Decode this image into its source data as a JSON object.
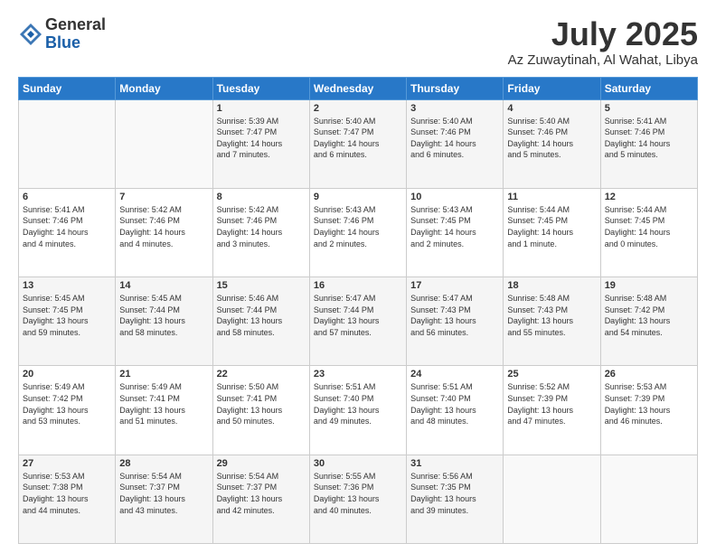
{
  "logo": {
    "general": "General",
    "blue": "Blue"
  },
  "title": "July 2025",
  "location": "Az Zuwaytinah, Al Wahat, Libya",
  "headers": [
    "Sunday",
    "Monday",
    "Tuesday",
    "Wednesday",
    "Thursday",
    "Friday",
    "Saturday"
  ],
  "weeks": [
    [
      {
        "day": "",
        "info": ""
      },
      {
        "day": "",
        "info": ""
      },
      {
        "day": "1",
        "info": "Sunrise: 5:39 AM\nSunset: 7:47 PM\nDaylight: 14 hours\nand 7 minutes."
      },
      {
        "day": "2",
        "info": "Sunrise: 5:40 AM\nSunset: 7:47 PM\nDaylight: 14 hours\nand 6 minutes."
      },
      {
        "day": "3",
        "info": "Sunrise: 5:40 AM\nSunset: 7:46 PM\nDaylight: 14 hours\nand 6 minutes."
      },
      {
        "day": "4",
        "info": "Sunrise: 5:40 AM\nSunset: 7:46 PM\nDaylight: 14 hours\nand 5 minutes."
      },
      {
        "day": "5",
        "info": "Sunrise: 5:41 AM\nSunset: 7:46 PM\nDaylight: 14 hours\nand 5 minutes."
      }
    ],
    [
      {
        "day": "6",
        "info": "Sunrise: 5:41 AM\nSunset: 7:46 PM\nDaylight: 14 hours\nand 4 minutes."
      },
      {
        "day": "7",
        "info": "Sunrise: 5:42 AM\nSunset: 7:46 PM\nDaylight: 14 hours\nand 4 minutes."
      },
      {
        "day": "8",
        "info": "Sunrise: 5:42 AM\nSunset: 7:46 PM\nDaylight: 14 hours\nand 3 minutes."
      },
      {
        "day": "9",
        "info": "Sunrise: 5:43 AM\nSunset: 7:46 PM\nDaylight: 14 hours\nand 2 minutes."
      },
      {
        "day": "10",
        "info": "Sunrise: 5:43 AM\nSunset: 7:45 PM\nDaylight: 14 hours\nand 2 minutes."
      },
      {
        "day": "11",
        "info": "Sunrise: 5:44 AM\nSunset: 7:45 PM\nDaylight: 14 hours\nand 1 minute."
      },
      {
        "day": "12",
        "info": "Sunrise: 5:44 AM\nSunset: 7:45 PM\nDaylight: 14 hours\nand 0 minutes."
      }
    ],
    [
      {
        "day": "13",
        "info": "Sunrise: 5:45 AM\nSunset: 7:45 PM\nDaylight: 13 hours\nand 59 minutes."
      },
      {
        "day": "14",
        "info": "Sunrise: 5:45 AM\nSunset: 7:44 PM\nDaylight: 13 hours\nand 58 minutes."
      },
      {
        "day": "15",
        "info": "Sunrise: 5:46 AM\nSunset: 7:44 PM\nDaylight: 13 hours\nand 58 minutes."
      },
      {
        "day": "16",
        "info": "Sunrise: 5:47 AM\nSunset: 7:44 PM\nDaylight: 13 hours\nand 57 minutes."
      },
      {
        "day": "17",
        "info": "Sunrise: 5:47 AM\nSunset: 7:43 PM\nDaylight: 13 hours\nand 56 minutes."
      },
      {
        "day": "18",
        "info": "Sunrise: 5:48 AM\nSunset: 7:43 PM\nDaylight: 13 hours\nand 55 minutes."
      },
      {
        "day": "19",
        "info": "Sunrise: 5:48 AM\nSunset: 7:42 PM\nDaylight: 13 hours\nand 54 minutes."
      }
    ],
    [
      {
        "day": "20",
        "info": "Sunrise: 5:49 AM\nSunset: 7:42 PM\nDaylight: 13 hours\nand 53 minutes."
      },
      {
        "day": "21",
        "info": "Sunrise: 5:49 AM\nSunset: 7:41 PM\nDaylight: 13 hours\nand 51 minutes."
      },
      {
        "day": "22",
        "info": "Sunrise: 5:50 AM\nSunset: 7:41 PM\nDaylight: 13 hours\nand 50 minutes."
      },
      {
        "day": "23",
        "info": "Sunrise: 5:51 AM\nSunset: 7:40 PM\nDaylight: 13 hours\nand 49 minutes."
      },
      {
        "day": "24",
        "info": "Sunrise: 5:51 AM\nSunset: 7:40 PM\nDaylight: 13 hours\nand 48 minutes."
      },
      {
        "day": "25",
        "info": "Sunrise: 5:52 AM\nSunset: 7:39 PM\nDaylight: 13 hours\nand 47 minutes."
      },
      {
        "day": "26",
        "info": "Sunrise: 5:53 AM\nSunset: 7:39 PM\nDaylight: 13 hours\nand 46 minutes."
      }
    ],
    [
      {
        "day": "27",
        "info": "Sunrise: 5:53 AM\nSunset: 7:38 PM\nDaylight: 13 hours\nand 44 minutes."
      },
      {
        "day": "28",
        "info": "Sunrise: 5:54 AM\nSunset: 7:37 PM\nDaylight: 13 hours\nand 43 minutes."
      },
      {
        "day": "29",
        "info": "Sunrise: 5:54 AM\nSunset: 7:37 PM\nDaylight: 13 hours\nand 42 minutes."
      },
      {
        "day": "30",
        "info": "Sunrise: 5:55 AM\nSunset: 7:36 PM\nDaylight: 13 hours\nand 40 minutes."
      },
      {
        "day": "31",
        "info": "Sunrise: 5:56 AM\nSunset: 7:35 PM\nDaylight: 13 hours\nand 39 minutes."
      },
      {
        "day": "",
        "info": ""
      },
      {
        "day": "",
        "info": ""
      }
    ]
  ]
}
